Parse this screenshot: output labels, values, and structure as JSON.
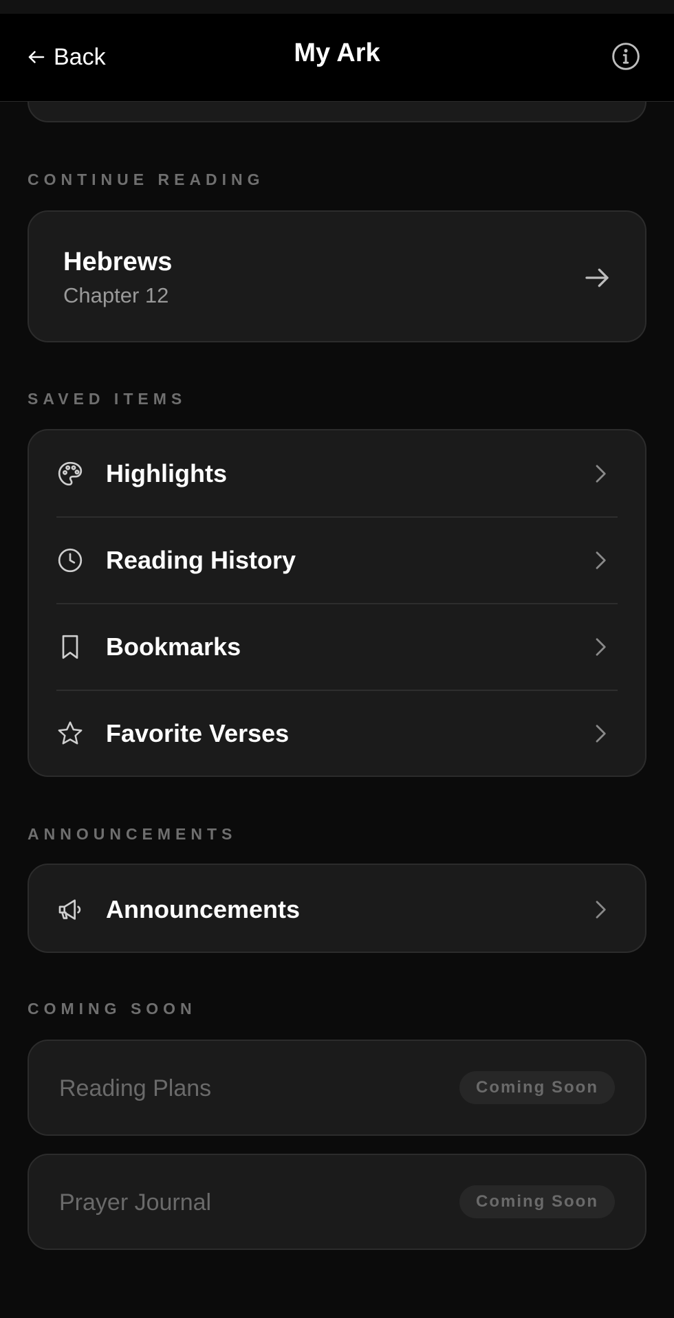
{
  "header": {
    "back_label": "Back",
    "title": "My Ark",
    "back_icon": "arrow-left-icon",
    "info_icon": "info-circle-icon"
  },
  "sections": {
    "continue_reading": {
      "label": "CONTINUE READING",
      "book": "Hebrews",
      "chapter": "Chapter 12",
      "icon": "arrow-right-icon"
    },
    "saved_items": {
      "label": "SAVED ITEMS",
      "items": [
        {
          "label": "Highlights",
          "icon": "palette-icon"
        },
        {
          "label": "Reading History",
          "icon": "clock-icon"
        },
        {
          "label": "Bookmarks",
          "icon": "bookmark-icon"
        },
        {
          "label": "Favorite Verses",
          "icon": "star-icon"
        }
      ]
    },
    "announcements": {
      "label": "ANNOUNCEMENTS",
      "items": [
        {
          "label": "Announcements",
          "icon": "megaphone-icon"
        }
      ]
    },
    "coming_soon": {
      "label": "COMING SOON",
      "items": [
        {
          "label": "Reading Plans",
          "badge": "Coming Soon"
        },
        {
          "label": "Prayer Journal",
          "badge": "Coming Soon"
        }
      ]
    }
  },
  "colors": {
    "background": "#0b0b0b",
    "header": "#000000",
    "card": "#1b1b1b",
    "card_border": "#2c2c2c",
    "section_label": "#6f6f6f",
    "text_primary": "#ffffff",
    "text_secondary": "#9a9a9a",
    "disabled_text": "#6a6a6a"
  }
}
